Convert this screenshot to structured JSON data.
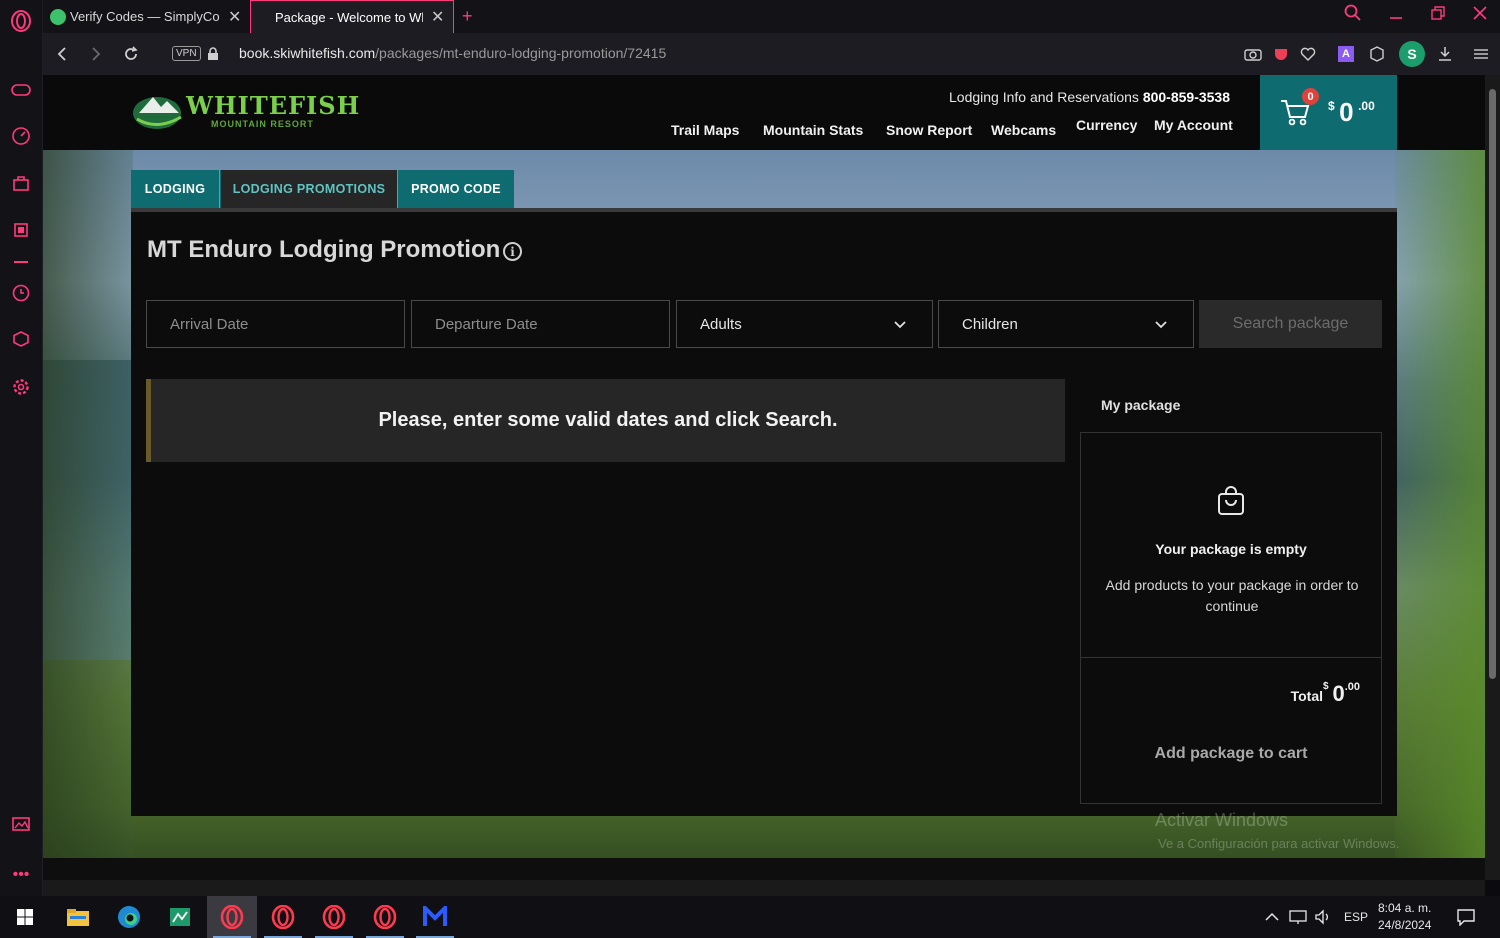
{
  "browser": {
    "tabs": [
      {
        "title": "Verify Codes — SimplyCodes",
        "active": false
      },
      {
        "title": "Package - Welcome to Whitefish",
        "active": true
      }
    ],
    "new_tab": "+",
    "url_host": "book.skiwhitefish.com",
    "url_path": "/packages/mt-enduro-lodging-promotion/72415",
    "vpn_label": "VPN",
    "profile_initial": "S"
  },
  "site": {
    "logo_text": "WHITEFISH",
    "logo_sub": "MOUNTAIN RESORT",
    "lodging_info_label": "Lodging Info and Reservations",
    "lodging_phone": "800-859-3538",
    "nav": [
      "Trail Maps",
      "Mountain Stats",
      "Snow Report",
      "Webcams",
      "Currency",
      "My Account"
    ],
    "cart_count": "0",
    "cart_currency": "$",
    "cart_amount": "0",
    "cart_cents": ".00"
  },
  "booking": {
    "tabs": [
      "LODGING",
      "LODGING PROMOTIONS",
      "PROMO CODE"
    ],
    "title": "MT Enduro Lodging Promotion",
    "arrival_placeholder": "Arrival Date",
    "departure_placeholder": "Departure Date",
    "adults_label": "Adults",
    "children_label": "Children",
    "search_button": "Search package",
    "notice": "Please, enter some valid dates and click Search."
  },
  "package": {
    "label": "My package",
    "empty_title": "Your package is empty",
    "empty_desc": "Add products to your package in order to continue",
    "total_label": "Total",
    "total_currency": "$",
    "total_amount": "0",
    "total_cents": ".00",
    "add_button": "Add package to cart"
  },
  "watermark": {
    "line1": "Activar Windows",
    "line2": "Ve a Configuración para activar Windows."
  },
  "taskbar": {
    "lang": "ESP",
    "time": "8:04 a. m.",
    "date": "24/8/2024"
  },
  "colors": {
    "accent_teal": "#0e6b70",
    "opera_pink": "#ff3a7c",
    "badge_red": "#e0413a",
    "logo_green": "#7ccf4a"
  }
}
